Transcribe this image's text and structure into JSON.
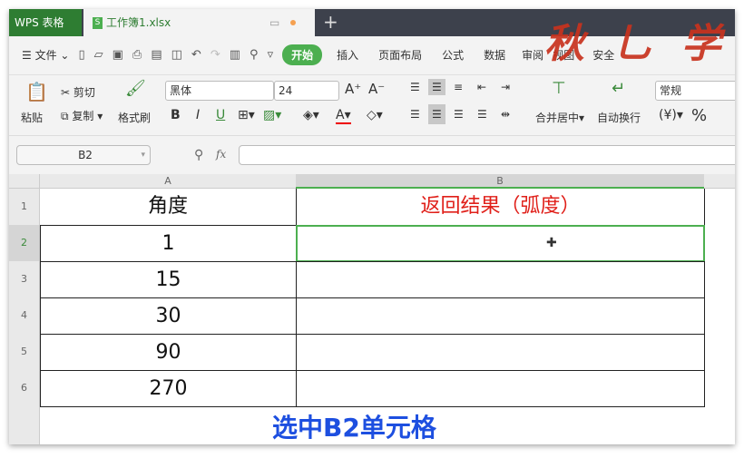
{
  "tabs": {
    "app": "WPS 表格",
    "doc": "工作簿1.xlsx",
    "doc_icon": "S"
  },
  "menu": {
    "file": "文件",
    "items": [
      "开始",
      "插入",
      "页面布局",
      "公式",
      "数据",
      "审阅",
      "视图",
      "安全"
    ]
  },
  "ribbon": {
    "paste": "粘贴",
    "cut": "剪切",
    "copy": "复制",
    "format_painter": "格式刷",
    "font": "黑体",
    "size": "24",
    "bold": "B",
    "italic": "I",
    "underline": "U",
    "merge": "合并居中",
    "wrap": "自动换行",
    "number_format": "常规",
    "currency": "¥",
    "percent": "%"
  },
  "formula_bar": {
    "name_box": "B2",
    "fx": "fx",
    "value": ""
  },
  "columns": [
    "A",
    "B"
  ],
  "rows": [
    {
      "n": "1",
      "a": "角度",
      "b": "返回结果（弧度）"
    },
    {
      "n": "2",
      "a": "1",
      "b": ""
    },
    {
      "n": "3",
      "a": "15",
      "b": ""
    },
    {
      "n": "4",
      "a": "30",
      "b": ""
    },
    {
      "n": "5",
      "a": "90",
      "b": ""
    },
    {
      "n": "6",
      "a": "270",
      "b": ""
    }
  ],
  "caption": "选中B2单元格",
  "watermark": "秋叶学",
  "colors": {
    "green": "#4caf50",
    "header_red": "#e0201a",
    "caption_blue": "#1d4fe0"
  }
}
